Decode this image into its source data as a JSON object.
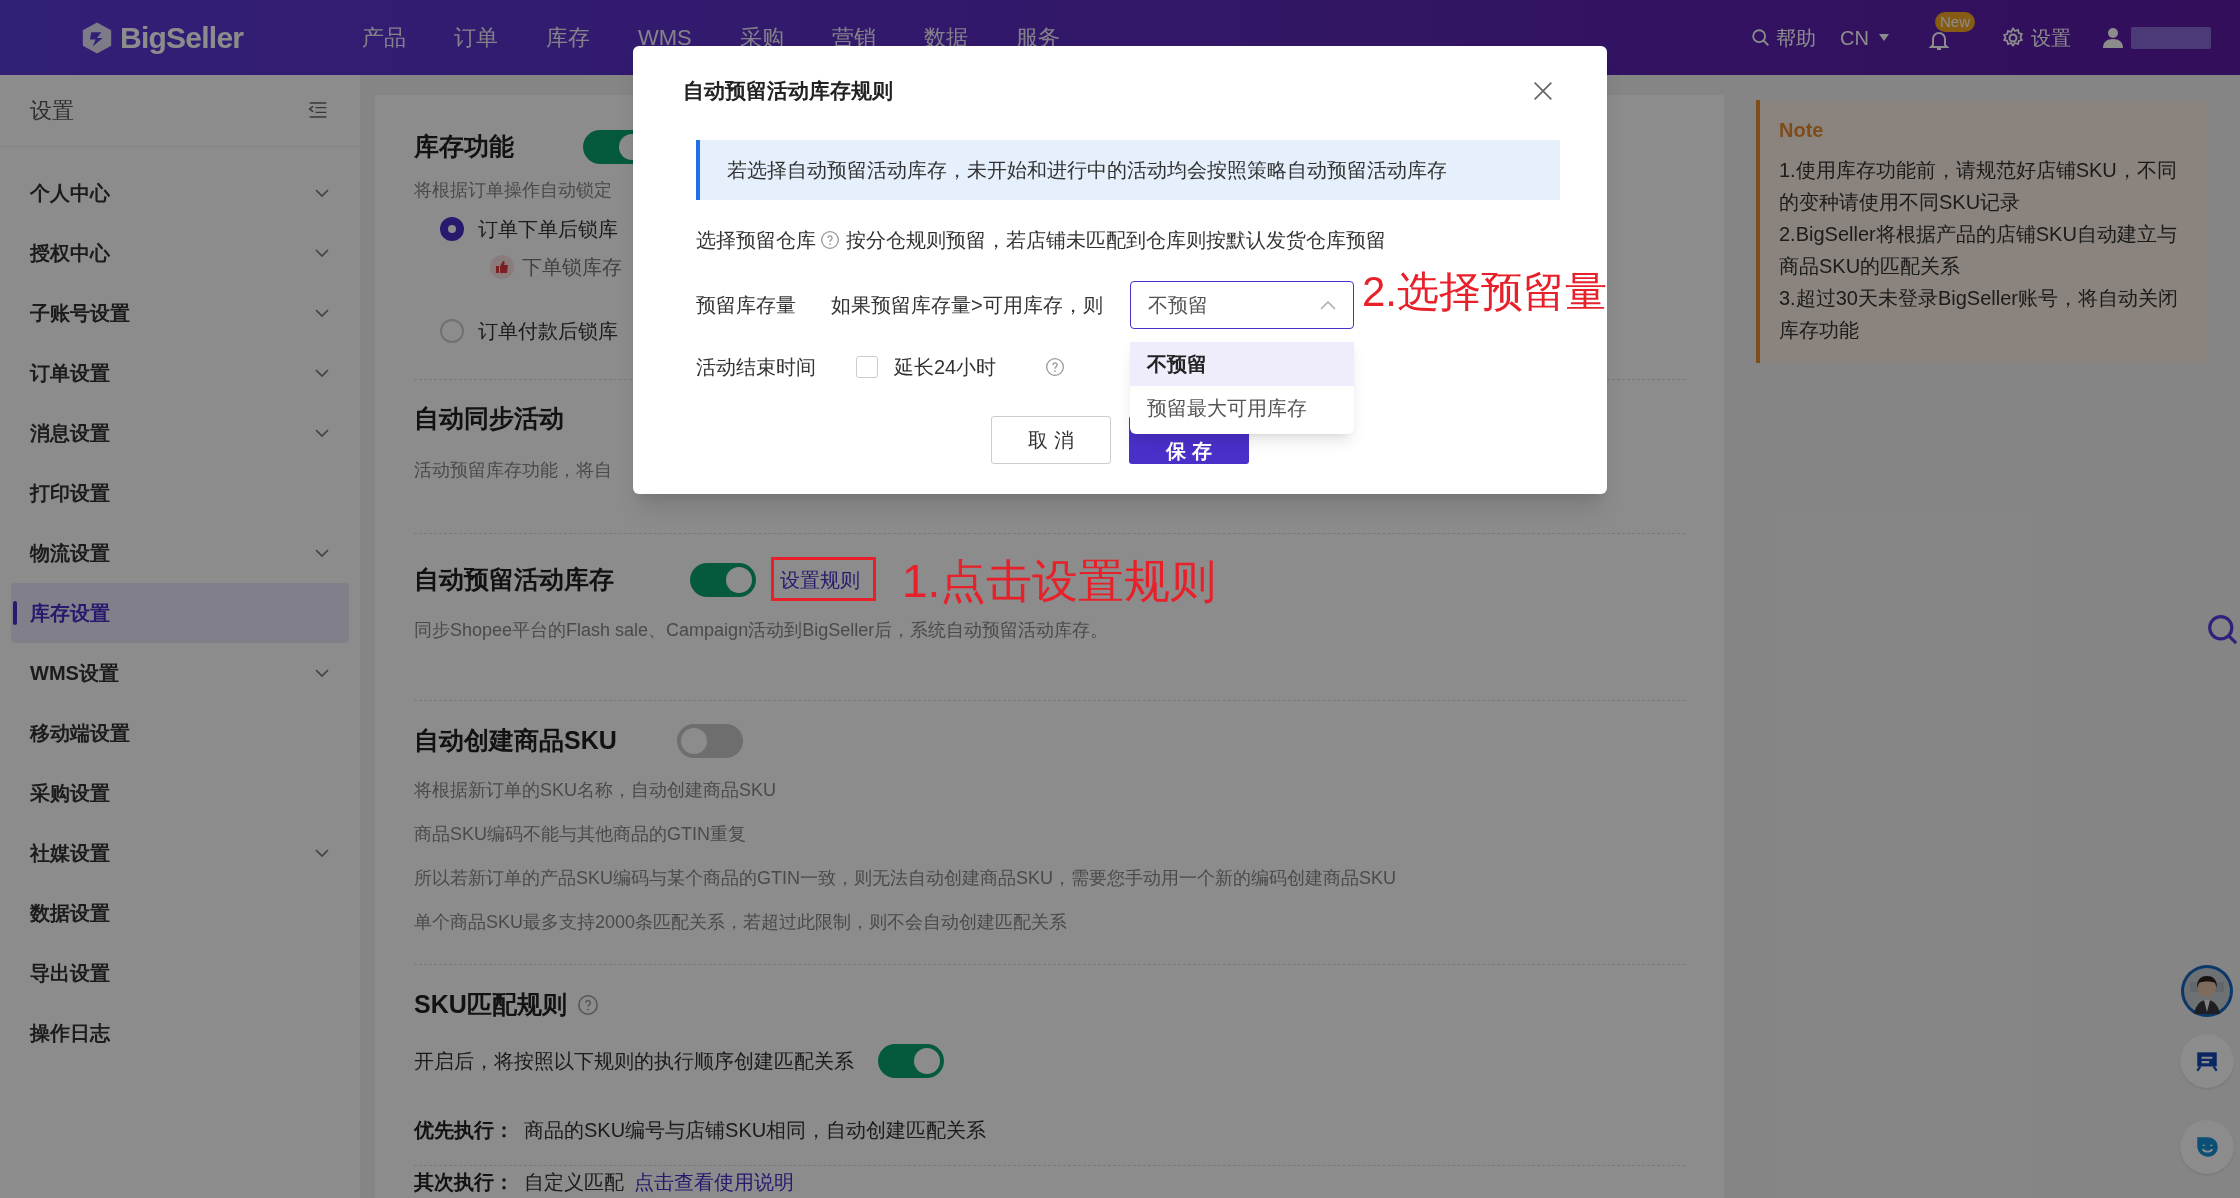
{
  "header": {
    "logo": "BigSeller",
    "nav": [
      {
        "label": "产品"
      },
      {
        "label": "订单"
      },
      {
        "label": "库存"
      },
      {
        "label": "WMS"
      },
      {
        "label": "采购"
      },
      {
        "label": "营销"
      },
      {
        "label": "数据"
      },
      {
        "label": "服务"
      }
    ],
    "help": "帮助",
    "language": "CN",
    "badge": "New",
    "settings": "设置"
  },
  "sidebar": {
    "title": "设置",
    "items": [
      {
        "label": "个人中心",
        "expandable": true,
        "selected": false
      },
      {
        "label": "授权中心",
        "expandable": true,
        "selected": false
      },
      {
        "label": "子账号设置",
        "expandable": true,
        "selected": false
      },
      {
        "label": "订单设置",
        "expandable": true,
        "selected": false
      },
      {
        "label": "消息设置",
        "expandable": true,
        "selected": false
      },
      {
        "label": "打印设置",
        "expandable": false,
        "selected": false
      },
      {
        "label": "物流设置",
        "expandable": true,
        "selected": false
      },
      {
        "label": "库存设置",
        "expandable": false,
        "selected": true
      },
      {
        "label": "WMS设置",
        "expandable": true,
        "selected": false
      },
      {
        "label": "移动端设置",
        "expandable": false,
        "selected": false
      },
      {
        "label": "采购设置",
        "expandable": false,
        "selected": false
      },
      {
        "label": "社媒设置",
        "expandable": true,
        "selected": false
      },
      {
        "label": "数据设置",
        "expandable": false,
        "selected": false
      },
      {
        "label": "导出设置",
        "expandable": false,
        "selected": false
      },
      {
        "label": "操作日志",
        "expandable": false,
        "selected": false
      }
    ]
  },
  "inventory_function": {
    "title": "库存功能",
    "on": true,
    "description": "将根据订单操作自动锁定",
    "options": [
      {
        "label": "订单下单后锁库",
        "selected": true,
        "tip": "下单锁库存"
      },
      {
        "label": "订单付款后锁库",
        "selected": false
      }
    ]
  },
  "auto_sync": {
    "title": "自动同步活动",
    "description": "活动预留库存功能，将自"
  },
  "auto_reserve": {
    "title": "自动预留活动库存",
    "on": true,
    "link": "设置规则",
    "description": "同步Shopee平台的Flash sale、Campaign活动到BigSeller后，系统自动预留活动库存。"
  },
  "auto_create_sku": {
    "title": "自动创建商品SKU",
    "on": false,
    "lines": [
      "将根据新订单的SKU名称，自动创建商品SKU",
      "商品SKU编码不能与其他商品的GTIN重复",
      "所以若新订单的产品SKU编码与某个商品的GTIN一致，则无法自动创建商品SKU，需要您手动用一个新的编码创建商品SKU",
      "单个商品SKU最多支持2000条匹配关系，若超过此限制，则不会自动创建匹配关系"
    ]
  },
  "sku_match": {
    "title": "SKU匹配规则",
    "description": "开启后，将按照以下规则的执行顺序创建匹配关系",
    "on": true,
    "rules": [
      {
        "label": "优先执行：",
        "text": "商品的SKU编号与店铺SKU相同，自动创建匹配关系"
      },
      {
        "label": "其次执行：",
        "text": "自定义匹配",
        "link": "点击查看使用说明"
      }
    ]
  },
  "note": {
    "title": "Note",
    "lines": [
      "1.使用库存功能前，请规范好店铺SKU，不同的变种请使用不同SKU记录",
      "2.BigSeller将根据产品的店铺SKU自动建立与商品SKU的匹配关系",
      "3.超过30天未登录BigSeller账号，将自动关闭库存功能"
    ]
  },
  "dialog": {
    "title": "自动预留活动库存规则",
    "info": "若选择自动预留活动库存，未开始和进行中的活动均会按照策略自动预留活动库存",
    "warehouse": {
      "label": "选择预留仓库",
      "text": "按分仓规则预留，若店铺未匹配到仓库则按默认发货仓库预留"
    },
    "quantity": {
      "label": "预留库存量",
      "condition": "如果预留库存量>可用库存，则",
      "value": "不预留",
      "expanded": true,
      "options": [
        {
          "label": "不预留",
          "selected": true
        },
        {
          "label": "预留最大可用库存",
          "selected": false
        }
      ]
    },
    "end_time": {
      "label": "活动结束时间",
      "checkbox_label": "延长24小时",
      "checked": false
    },
    "buttons": {
      "cancel": "取 消",
      "save": "保 存"
    }
  },
  "annotations": [
    "1.点击设置规则",
    "2.选择预留量"
  ]
}
